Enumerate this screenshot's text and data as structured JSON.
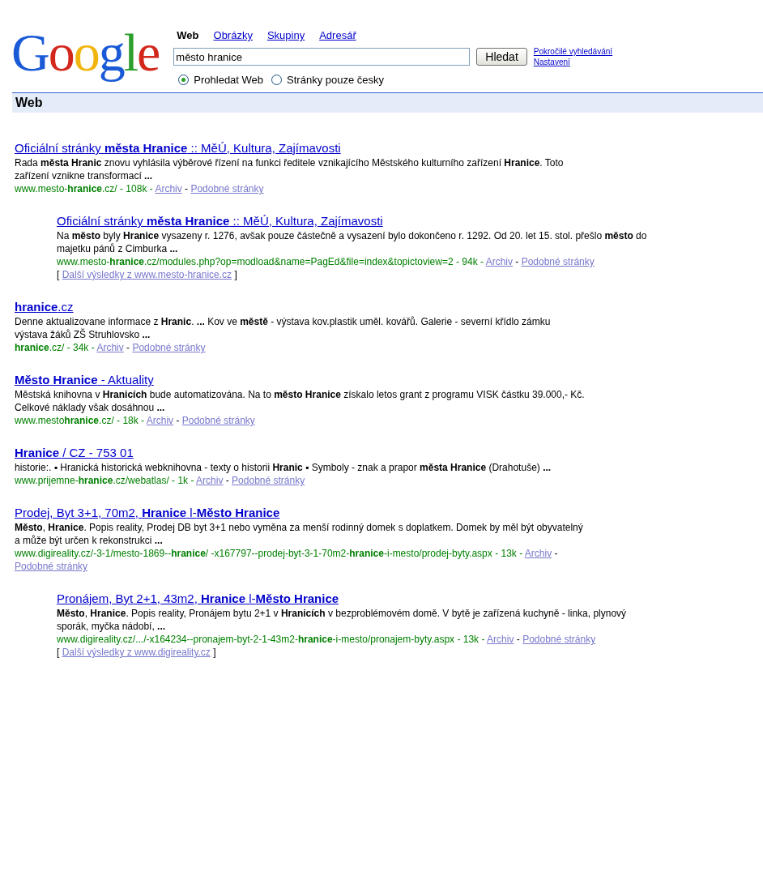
{
  "logo": "Google",
  "tabs": [
    {
      "label": "Web",
      "selected": true
    },
    {
      "label": "Obrázky",
      "selected": false
    },
    {
      "label": "Skupiny",
      "selected": false
    },
    {
      "label": "Adresář",
      "selected": false
    }
  ],
  "search": {
    "value": "město hranice",
    "button": "Hledat"
  },
  "side_links": [
    "Pokročilé vyhledávání",
    "Nastavení"
  ],
  "radios": [
    {
      "label": "Prohledat Web",
      "selected": true
    },
    {
      "label": "Stránky pouze česky",
      "selected": false
    }
  ],
  "section_title": "Web",
  "results": [
    {
      "indented": false,
      "title": "Oficiální stránky **města Hranice** :: MěÚ, Kultura, Zajímavosti",
      "snippet": "Rada **města Hranic** znovu vyhlásila výběrové řízení na funkci ředitele vznikajícího Městského kulturního zařízení **Hranice**. Toto zařízení vznikne transformací **...**",
      "url": "www.mesto-**hranice**.cz/ - 108k -",
      "cache": "Archiv",
      "separator": "-",
      "similar": "Podobné stránky"
    },
    {
      "indented": true,
      "title": "Oficiální stránky **města Hranice** :: MěÚ, Kultura, Zajímavosti",
      "snippet": "Na **město** byly **Hranice** vysazeny r. 1276, avšak pouze částečně a vysazení bylo dokončeno r. 1292. Od 20. let 15. stol. přešlo **město** do majetku pánů z Cimburka **...**",
      "url": "www.mesto-**hranice**.cz/modules.php?op=modload&name=PagEd&file=index&topictoview=2 - 94k -",
      "cache": "Archiv",
      "separator": "-",
      "similar": "Podobné stránky",
      "more": {
        "open": "[",
        "link": "Další výsledky z www.mesto-hranice.cz",
        "close": "]"
      }
    },
    {
      "indented": false,
      "title": "**hranice**.cz",
      "snippet": "Denne aktualizovane informace z **Hranic**. **...** Kov ve **městě** - výstava kov.plastik uměl. kovářů. Galerie - severní křídlo zámku výstava žáků ZŠ Struhlovsko **...**",
      "url": "**hranice**.cz/ - 34k -",
      "cache": "Archiv",
      "separator": "-",
      "similar": "Podobné stránky"
    },
    {
      "indented": false,
      "title": "**Město Hranice** - Aktuality",
      "snippet": "Městská knihovna v **Hranicích** bude automatizována. Na to **město Hranice** získalo letos grant z programu VISK částku 39.000,- Kč. Celkové náklady však dosáhnou **...**",
      "url": "www.mesto**hranice**.cz/ - 18k -",
      "cache": "Archiv",
      "separator": "-",
      "similar": "Podobné stránky"
    },
    {
      "indented": false,
      "title": "**Hranice** / CZ - 753 01",
      "snippet": "historie:. ▪ Hranická historická webknihovna - texty o historii **Hranic** ▪ Symboly - znak a prapor **města Hranice** (Drahotuše) **...**",
      "url": "www.prijemne-**hranice**.cz/webatlas/ - 1k -",
      "cache": "Archiv",
      "separator": "-",
      "similar": "Podobné stránky"
    },
    {
      "indented": false,
      "title": "Prodej, Byt 3+1, 70m2, **Hranice** l-**Město Hranice**",
      "snippet": "**Město**, **Hranice**. Popis reality, Prodej DB byt 3+1 nebo vyměna za menší rodinný domek s doplatkem. Domek by měl být obyvatelný a může být určen k rekonstrukci **...**",
      "url": "www.digireality.cz/-3-1/mesto-1869--**hranice**/ -x167797--prodej-byt-3-1-70m2-**hranice**-i-mesto/prodej-byty.aspx - 13k -",
      "cache": "Archiv",
      "separator": "-",
      "similar": "Podobné stránky"
    },
    {
      "indented": true,
      "title": "Pronájem, Byt 2+1, 43m2, **Hranice** l-**Město Hranice**",
      "snippet": "**Město**, **Hranice**. Popis reality, Pronájem bytu 2+1 v **Hranicích** v bezproblémovém domě. V bytě je zařízená kuchyně - linka, plynový sporák, myčka nádobí, **...**",
      "url": "www.digireality.cz/.../-x164234--pronajem-byt-2-1-43m2-**hranice**-i-mesto/pronajem-byty.aspx - 13k -",
      "cache": "Archiv",
      "separator": "-",
      "similar": "Podobné stránky",
      "more": {
        "open": "[",
        "link": "Další výsledky z www.digireality.cz",
        "close": "]"
      }
    }
  ]
}
